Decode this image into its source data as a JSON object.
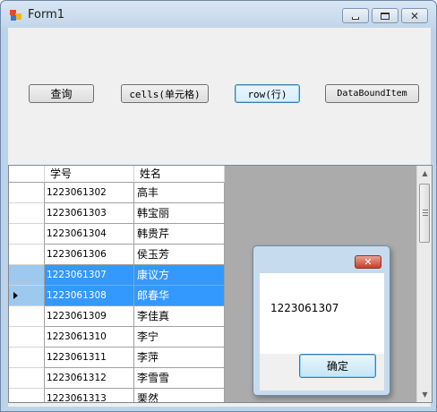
{
  "window": {
    "title": "Form1"
  },
  "toolbar": {
    "query_label": "查询",
    "cells_label": "cells(单元格)",
    "row_label": "row(行)",
    "databounditem_label": "DataBoundItem"
  },
  "grid": {
    "columns": [
      "学号",
      "姓名"
    ],
    "rows": [
      {
        "no": "1223061302",
        "name": "高丰",
        "selected": false
      },
      {
        "no": "1223061303",
        "name": "韩宝丽",
        "selected": false
      },
      {
        "no": "1223061304",
        "name": "韩贵芹",
        "selected": false
      },
      {
        "no": "1223061306",
        "name": "侯玉芳",
        "selected": false
      },
      {
        "no": "1223061307",
        "name": "康议方",
        "selected": true
      },
      {
        "no": "1223061308",
        "name": "郎春华",
        "selected": true,
        "current": true
      },
      {
        "no": "1223061309",
        "name": "李佳真",
        "selected": false
      },
      {
        "no": "1223061310",
        "name": "李宁",
        "selected": false
      },
      {
        "no": "1223061311",
        "name": "李萍",
        "selected": false
      },
      {
        "no": "1223061312",
        "name": "李雪雪",
        "selected": false
      },
      {
        "no": "1223061313",
        "name": "栗然",
        "selected": false
      }
    ]
  },
  "messagebox": {
    "text": "1223061307",
    "ok_label": "确定"
  },
  "colors": {
    "selection": "#3399ff",
    "grid_background": "#ababab"
  }
}
